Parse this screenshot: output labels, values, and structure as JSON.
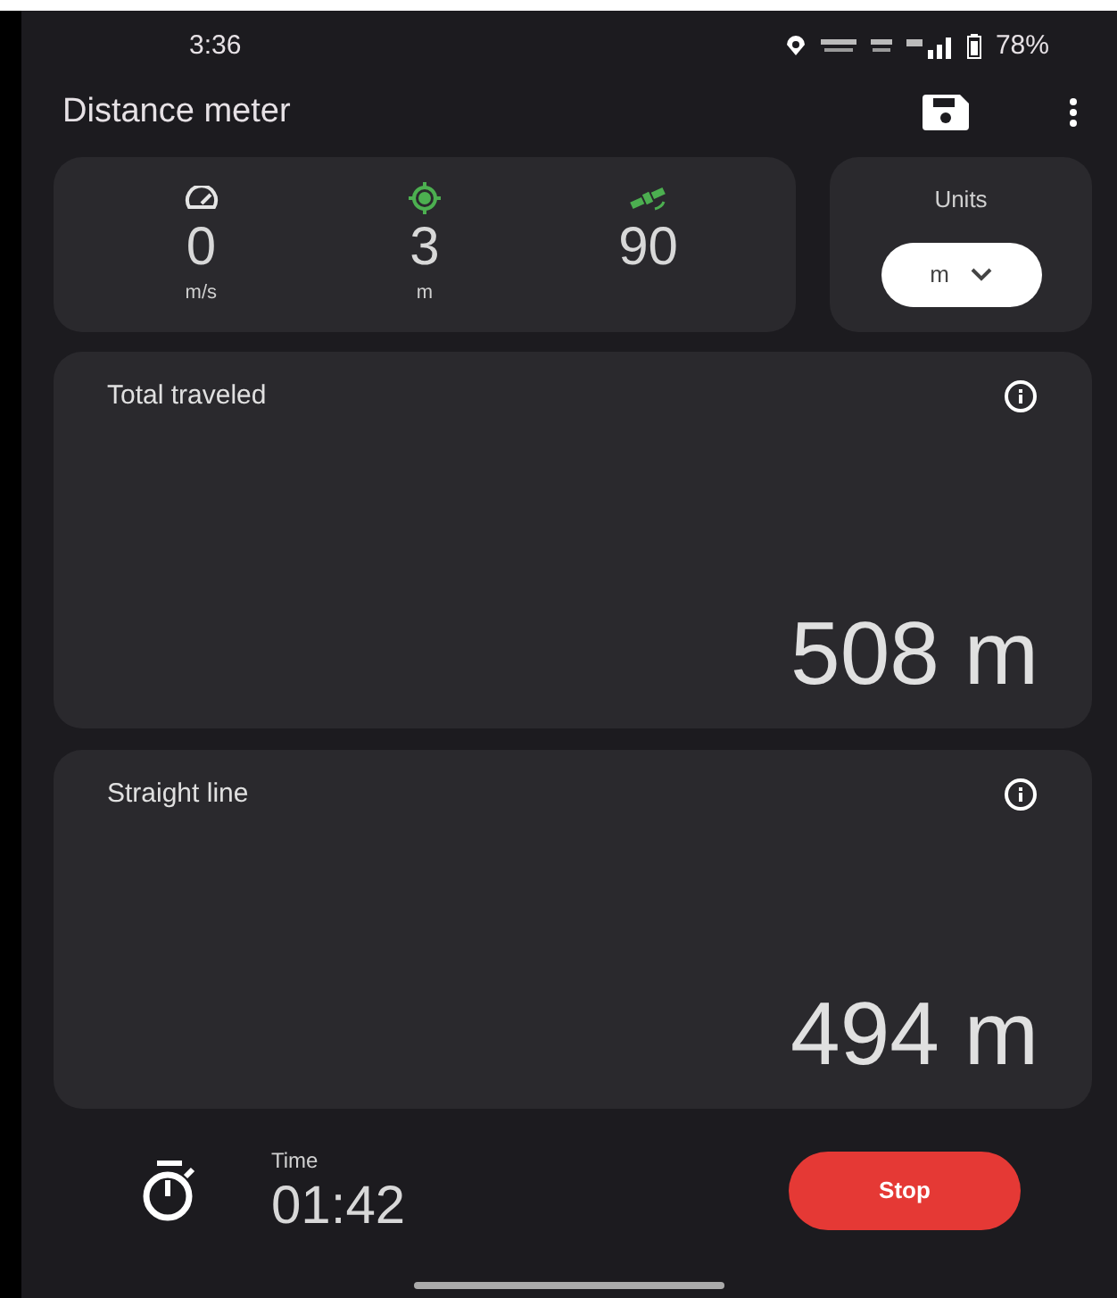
{
  "status_bar": {
    "time": "3:36",
    "battery": "78%"
  },
  "app_bar": {
    "title": "Distance meter"
  },
  "stats": [
    {
      "kind": "speed",
      "value": "0",
      "unit": "m/s"
    },
    {
      "kind": "accuracy",
      "value": "3",
      "unit": "m"
    },
    {
      "kind": "satellites",
      "value": "90"
    }
  ],
  "units": {
    "label": "Units",
    "value": "m"
  },
  "cards": [
    {
      "title": "Total traveled",
      "value": "508 m"
    },
    {
      "title": "Straight line",
      "value": "494 m"
    }
  ],
  "timer": {
    "label": "Time",
    "value": "01:42"
  },
  "stop_button": "Stop"
}
